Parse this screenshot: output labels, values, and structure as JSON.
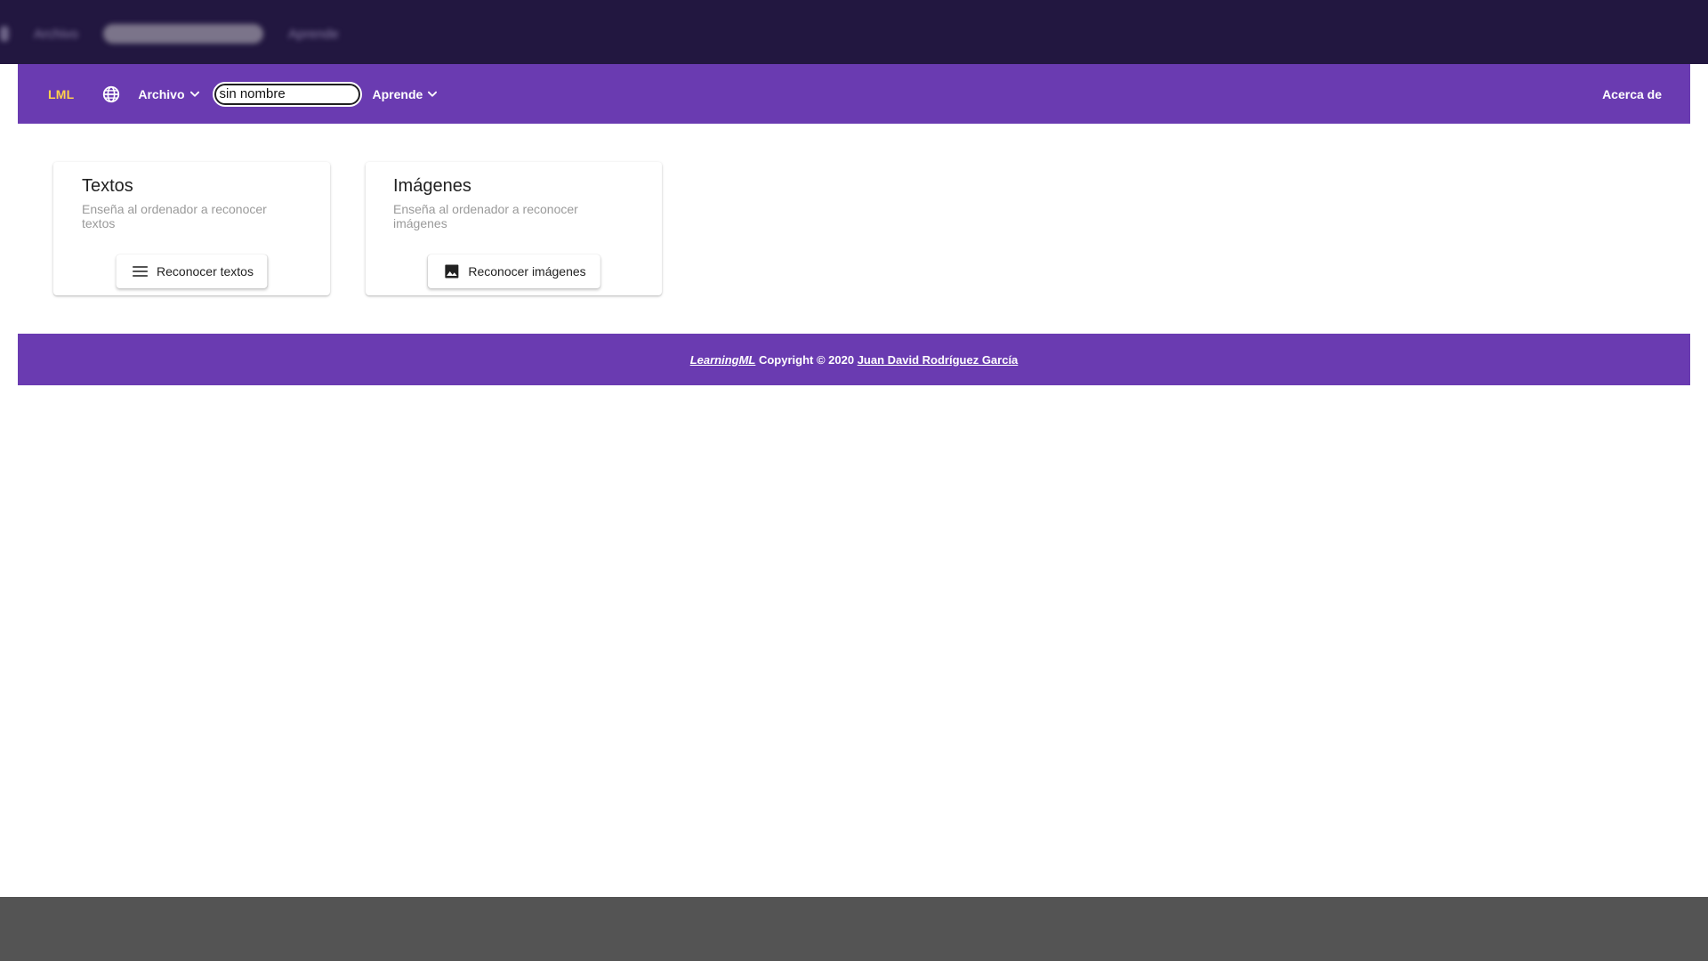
{
  "navbar": {
    "brand": "LML",
    "file_menu": "Archivo",
    "project_name_value": "sin nombre",
    "learn_menu": "Aprende",
    "about": "Acerca de",
    "accent_color": "#6a3bb1",
    "brand_color": "#ffd24a"
  },
  "cards": {
    "texts": {
      "title": "Textos",
      "subtitle": "Enseña al ordenador a reconocer textos",
      "button": "Reconocer textos",
      "icon": "lines-menu-icon"
    },
    "images": {
      "title": "Imágenes",
      "subtitle": "Enseña al ordenador a reconocer imágenes",
      "button": "Reconocer imágenes",
      "icon": "image-icon"
    }
  },
  "footer": {
    "brand_link": "LearningML",
    "copyright": " Copyright © 2020 ",
    "author_link": "Juan David Rodríguez García"
  }
}
